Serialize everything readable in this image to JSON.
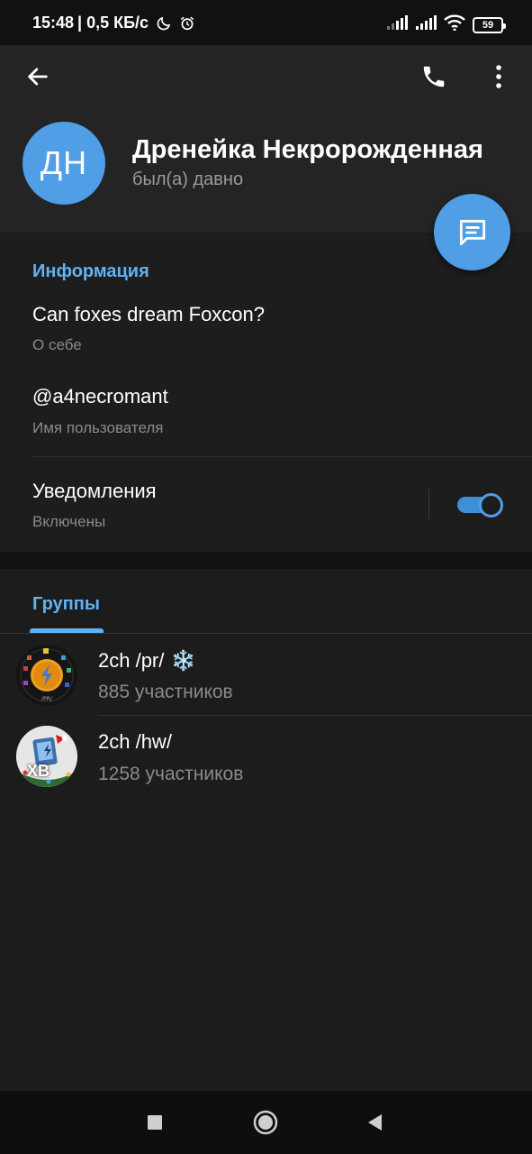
{
  "status_bar": {
    "time": "15:48",
    "speed": "| 0,5 КБ/с",
    "battery": "59",
    "icons": [
      "moon-icon",
      "alarm-icon",
      "signal-icon",
      "signal-icon",
      "wifi-icon",
      "battery-icon"
    ]
  },
  "header": {
    "back_icon": "arrow-left-icon",
    "call_icon": "phone-icon",
    "menu_icon": "more-vertical-icon",
    "avatar_initials": "ДН",
    "name": "Дренейка Некророжденная",
    "status": "был(а) давно",
    "message_button_icon": "message-icon"
  },
  "info": {
    "title": "Информация",
    "bio_value": "Can foxes dream Foxcon?",
    "bio_label": "О себе",
    "username_value": "@a4necromant",
    "username_label": "Имя пользователя",
    "notifications_value": "Уведомления",
    "notifications_label": "Включены",
    "notifications_enabled": true
  },
  "groups": {
    "tab_label": "Группы",
    "items": [
      {
        "title": "2ch /pr/",
        "emoji": "❄️",
        "members": "885 участников",
        "avatar_icon": "lightning-avatar-icon"
      },
      {
        "title": "2ch /hw/",
        "emoji": "",
        "members": "1258 участников",
        "avatar_icon": "xb-avatar-icon",
        "avatar_text": "XB"
      }
    ]
  },
  "colors": {
    "accent": "#5fb2f5",
    "avatar_bg": "#4f9ee6",
    "header_bg": "#242424",
    "background": "#1b1b1b"
  }
}
